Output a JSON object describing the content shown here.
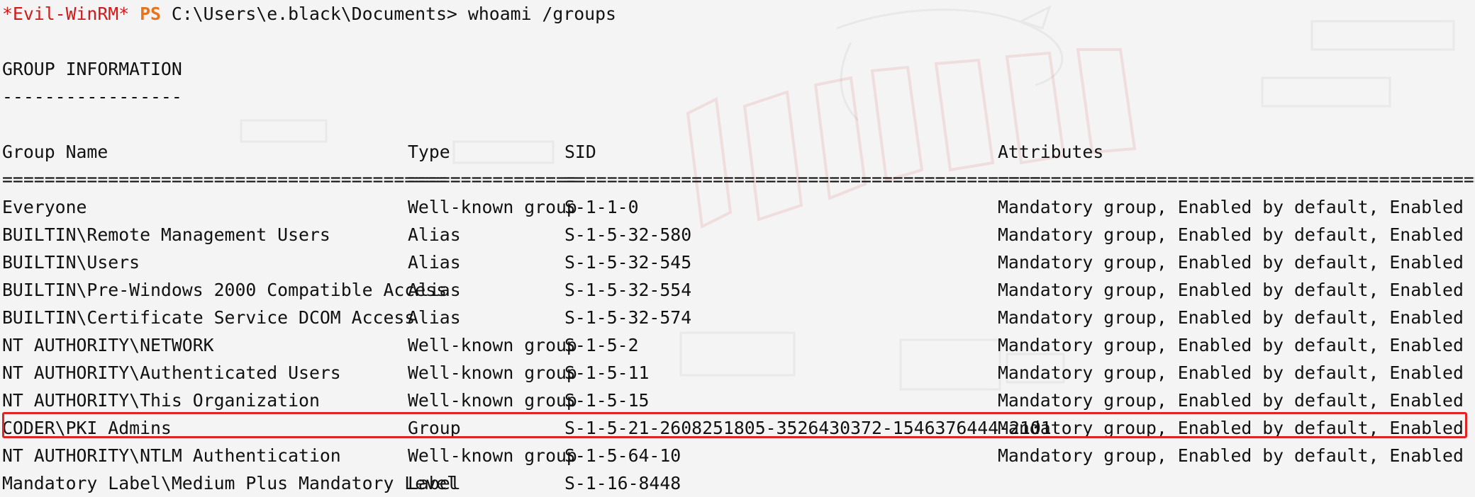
{
  "prompt": {
    "evil_label": "*Evil-WinRM*",
    "ps_label": "PS",
    "path": "C:\\Users\\e.black\\Documents>",
    "command": "whoami /groups"
  },
  "section": {
    "title": "GROUP INFORMATION",
    "underline": "-----------------"
  },
  "table": {
    "headers": {
      "name": "Group Name",
      "type": "Type",
      "sid": "SID",
      "attributes": "Attributes"
    },
    "separators": {
      "name": "==========================================",
      "type": "================",
      "sid": "=============================================",
      "attributes": "=================================================="
    },
    "rows": [
      {
        "name": "Everyone",
        "type": "Well-known group",
        "sid": "S-1-1-0",
        "attributes": "Mandatory group, Enabled by default, Enabled group"
      },
      {
        "name": "BUILTIN\\Remote Management Users",
        "type": "Alias",
        "sid": "S-1-5-32-580",
        "attributes": "Mandatory group, Enabled by default, Enabled group"
      },
      {
        "name": "BUILTIN\\Users",
        "type": "Alias",
        "sid": "S-1-5-32-545",
        "attributes": "Mandatory group, Enabled by default, Enabled group"
      },
      {
        "name": "BUILTIN\\Pre-Windows 2000 Compatible Access",
        "type": "Alias",
        "sid": "S-1-5-32-554",
        "attributes": "Mandatory group, Enabled by default, Enabled group"
      },
      {
        "name": "BUILTIN\\Certificate Service DCOM Access",
        "type": "Alias",
        "sid": "S-1-5-32-574",
        "attributes": "Mandatory group, Enabled by default, Enabled group"
      },
      {
        "name": "NT AUTHORITY\\NETWORK",
        "type": "Well-known group",
        "sid": "S-1-5-2",
        "attributes": "Mandatory group, Enabled by default, Enabled group"
      },
      {
        "name": "NT AUTHORITY\\Authenticated Users",
        "type": "Well-known group",
        "sid": "S-1-5-11",
        "attributes": "Mandatory group, Enabled by default, Enabled group"
      },
      {
        "name": "NT AUTHORITY\\This Organization",
        "type": "Well-known group",
        "sid": "S-1-5-15",
        "attributes": "Mandatory group, Enabled by default, Enabled group"
      },
      {
        "name": "CODER\\PKI Admins",
        "type": "Group",
        "sid": "S-1-5-21-2608251805-3526430372-1546376444-2101",
        "attributes": "Mandatory group, Enabled by default, Enabled group"
      },
      {
        "name": "NT AUTHORITY\\NTLM Authentication",
        "type": "Well-known group",
        "sid": "S-1-5-64-10",
        "attributes": "Mandatory group, Enabled by default, Enabled group"
      },
      {
        "name": "Mandatory Label\\Medium Plus Mandatory Level",
        "type": "Label",
        "sid": "S-1-16-8448",
        "attributes": ""
      }
    ],
    "highlighted_row_index": 8
  },
  "colors": {
    "background": "#f4f4f4",
    "text": "#111111",
    "evil_winrm": "#d11a1a",
    "ps": "#e8731c",
    "highlight_border": "#e02424"
  },
  "icons": {
    "background_watermark": "kali-dragon-watermark-icon"
  }
}
